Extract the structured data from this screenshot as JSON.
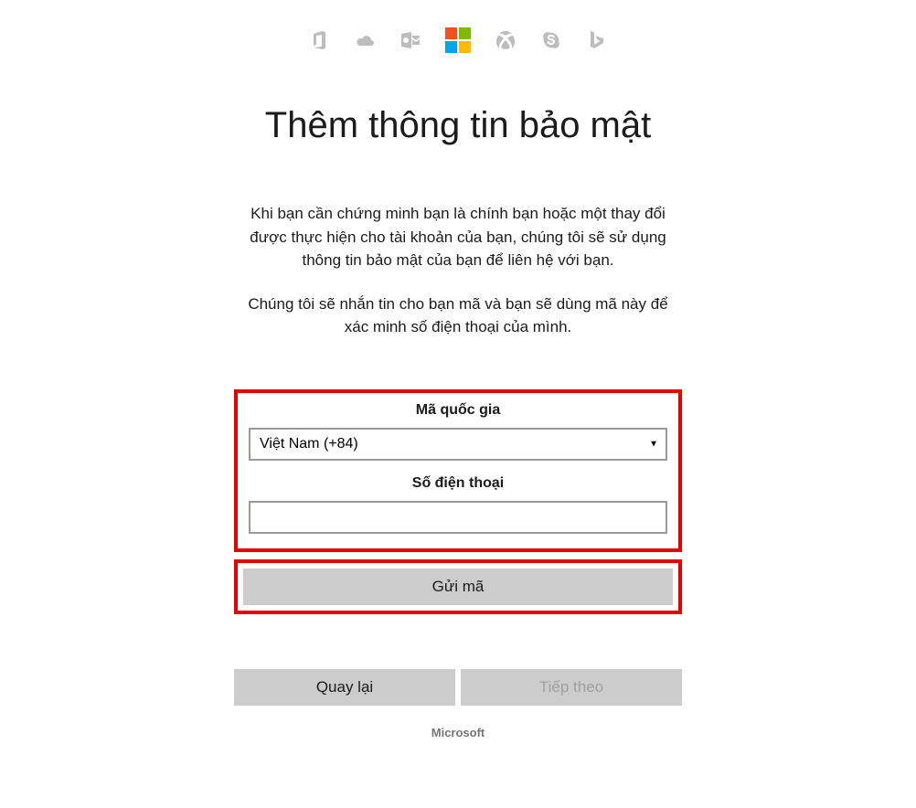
{
  "header": {
    "icons": [
      "office-icon",
      "onedrive-icon",
      "outlook-icon",
      "microsoft-logo",
      "xbox-icon",
      "skype-icon",
      "bing-icon"
    ]
  },
  "page": {
    "title": "Thêm thông tin bảo mật",
    "description1": "Khi bạn cần chứng minh bạn là chính bạn hoặc một thay đổi được thực hiện cho tài khoản của bạn, chúng tôi sẽ sử dụng thông tin bảo mật của bạn để liên hệ với bạn.",
    "description2": "Chúng tôi sẽ nhắn tin cho bạn mã và bạn sẽ dùng mã này để xác minh số điện thoại của mình."
  },
  "form": {
    "country_label": "Mã quốc gia",
    "country_selected": "Việt Nam (+84)",
    "phone_label": "Số điện thoại",
    "phone_value": "",
    "send_code_label": "Gửi mã"
  },
  "nav": {
    "back_label": "Quay lại",
    "next_label": "Tiếp theo"
  },
  "footer": {
    "brand": "Microsoft"
  }
}
